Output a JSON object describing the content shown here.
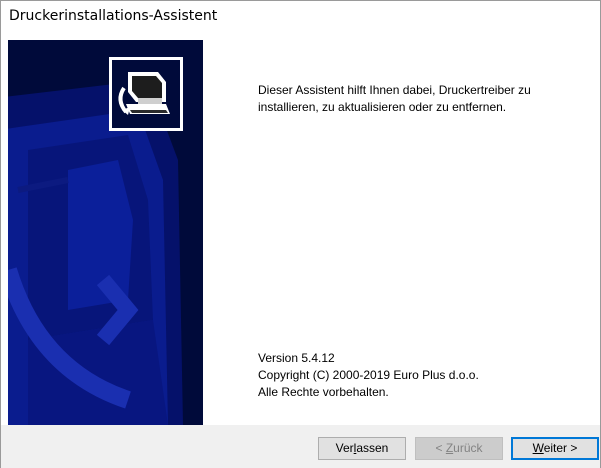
{
  "window": {
    "title": "Druckerinstallations-Assistent"
  },
  "main": {
    "description": "Dieser Assistent hilft Ihnen dabei, Druckertreiber zu installieren, zu aktualisieren oder zu entfernen.",
    "version": "Version 5.4.12",
    "copyright": "Copyright (C) 2000-2019 Euro Plus d.o.o.",
    "rights": "Alle Rechte vorbehalten."
  },
  "buttons": {
    "exit": {
      "pre": "Ver",
      "acc": "l",
      "post": "assen"
    },
    "back": {
      "pre": "< ",
      "acc": "Z",
      "post": "urück"
    },
    "next": {
      "pre": "",
      "acc": "W",
      "post": "eiter >"
    }
  },
  "banner_icon": "printer-wizard-icon",
  "colors": {
    "banner": "#000a3a",
    "accent": "#0078d7"
  }
}
